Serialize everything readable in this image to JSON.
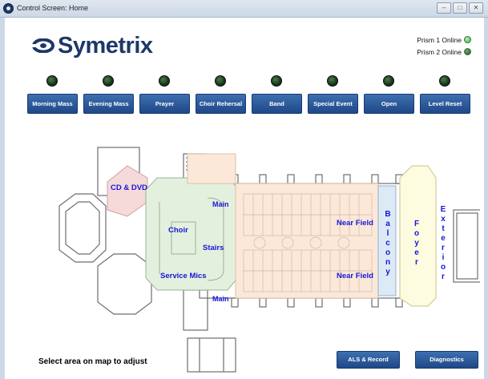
{
  "window": {
    "title": "Control Screen: Home",
    "icon": "symetrix-app-icon",
    "controls": [
      "minimize-icon",
      "maximize-icon",
      "close-icon"
    ]
  },
  "logo": {
    "text": "Symetrix",
    "color": "#1c3866"
  },
  "status": [
    {
      "label": "Prism 1 Online",
      "state": "on",
      "color": "#6cd46c"
    },
    {
      "label": "Prism 2 Online",
      "state": "dim",
      "color": "#3e7a3e"
    }
  ],
  "presets": [
    {
      "label": "Morning Mass",
      "led": "off"
    },
    {
      "label": "Evening Mass",
      "led": "off"
    },
    {
      "label": "Prayer",
      "led": "off"
    },
    {
      "label": "Choir Rehersal",
      "led": "off"
    },
    {
      "label": "Band",
      "led": "off"
    },
    {
      "label": "Special Event",
      "led": "off"
    },
    {
      "label": "Open",
      "led": "off"
    },
    {
      "label": "Level Reset",
      "led": "off"
    }
  ],
  "map": {
    "zones": {
      "cd_dvd": "CD & DVD",
      "main_top": "Main",
      "choir": "Choir",
      "stairs": "Stairs",
      "service_mics": "Service Mics",
      "main_bottom": "Main",
      "near_field_top": "Near Field",
      "near_field_bottom": "Near Field",
      "balcony": "Balcony",
      "foyer": "Foyer",
      "exterior": "Exterior"
    },
    "colors": {
      "cd_dvd": "#f6d9d9",
      "choir": "#e3f0de",
      "nave": "#fbe8d8",
      "balcony": "#dceaf5",
      "foyer": "#fdfbe0",
      "label": "#1616d8"
    }
  },
  "footer": {
    "hint": "Select area on map to adjust",
    "als_button": "ALS & Record",
    "diagnostics_button": "Diagnostics"
  }
}
